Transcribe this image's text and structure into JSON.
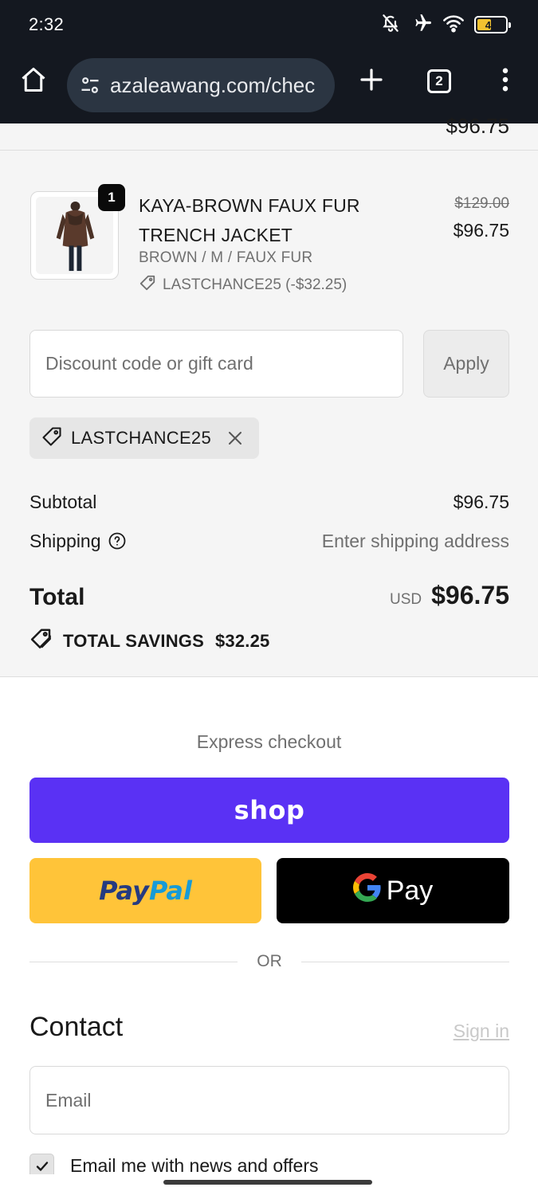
{
  "status_bar": {
    "time": "2:32",
    "battery_level": "44",
    "icons": [
      "bell-off-icon",
      "airplane-icon",
      "wifi-icon",
      "battery-icon"
    ]
  },
  "browser": {
    "url": "azaleawang.com/chec",
    "tab_count": "2",
    "icons": [
      "home-icon",
      "site-settings-icon",
      "new-tab-icon",
      "tabs-icon",
      "more-icon"
    ]
  },
  "summary": {
    "scrolled_price": "$96.75",
    "item": {
      "quantity": "1",
      "title": "KAYA-BROWN FAUX FUR TRENCH JACKET",
      "variant": "BROWN / M / FAUX FUR",
      "discount_line": "LASTCHANCE25 (-$32.25)",
      "original_price": "$129.00",
      "price": "$96.75"
    },
    "discount": {
      "placeholder": "Discount code or gift card",
      "value": "",
      "apply_label": "Apply"
    },
    "applied_code": "LASTCHANCE25",
    "subtotal_label": "Subtotal",
    "subtotal_value": "$96.75",
    "shipping_label": "Shipping",
    "shipping_value": "Enter shipping address",
    "total_label": "Total",
    "total_currency": "USD",
    "total_amount": "$96.75",
    "savings_label": "TOTAL SAVINGS",
    "savings_amount": "$32.25"
  },
  "checkout": {
    "express_title": "Express checkout",
    "shop_label": "shop",
    "paypal_pay": "Pay",
    "paypal_pal": "Pal",
    "gpay_label": "Pay",
    "or_label": "OR",
    "contact_title": "Contact",
    "sign_in_label": "Sign in",
    "email_placeholder": "Email",
    "email_value": "",
    "newsletter_label": "Email me with news and offers",
    "newsletter_checked": true
  },
  "colors": {
    "chrome_bg": "#141820",
    "shop_purple": "#5a31f4",
    "paypal_yellow": "#ffc439",
    "paypal_navy": "#253b80",
    "paypal_blue": "#179bd7",
    "summary_bg": "#f5f5f5"
  }
}
